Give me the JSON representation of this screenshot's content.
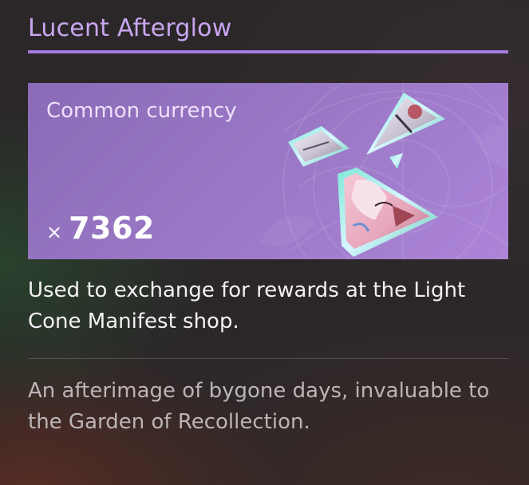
{
  "item": {
    "name": "Lucent Afterglow",
    "category": "Common currency",
    "quantity_prefix": "×",
    "quantity": "7362",
    "description": "Used to exchange for rewards at the Light Cone Manifest shop.",
    "flavor_text": "An afterimage of bygone days, invaluable to the Garden of Recollection.",
    "icon": "light-cone-shards-icon"
  },
  "colors": {
    "title": "#c9a6f0",
    "accent_rule": "#a67ce2",
    "card_background": "#9977c4",
    "description_text": "#f4f1f3",
    "flavor_text": "#bcb4b6"
  }
}
